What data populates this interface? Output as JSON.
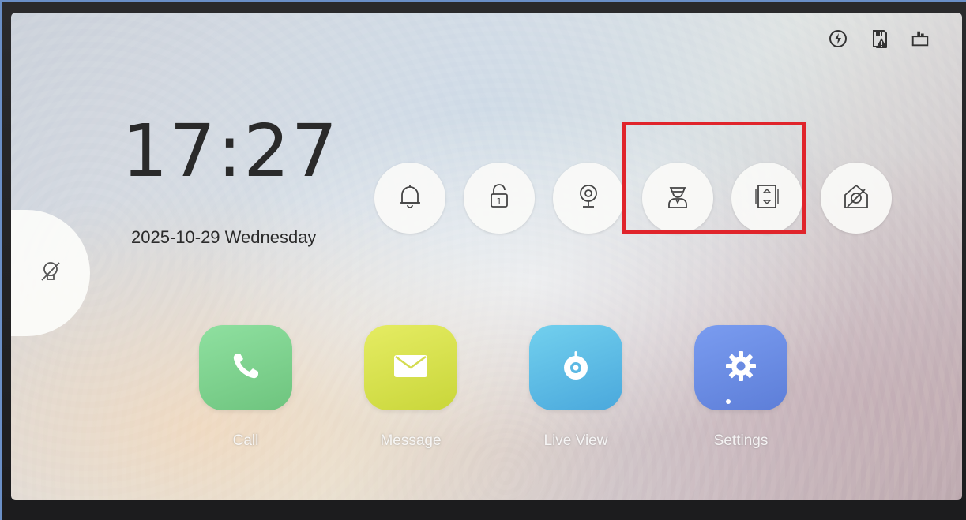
{
  "status_bar": {
    "icons": [
      "power-icon",
      "sd-card-warning-icon",
      "network-port-icon"
    ]
  },
  "clock": {
    "time": "17:27",
    "date": "2025-10-29 Wednesday"
  },
  "quick_actions": [
    {
      "icon": "bell-icon"
    },
    {
      "icon": "unlock-1-icon"
    },
    {
      "icon": "camera-icon"
    },
    {
      "icon": "guard-icon"
    },
    {
      "icon": "elevator-icon"
    },
    {
      "icon": "disarm-home-icon"
    }
  ],
  "highlight": {
    "color": "#e0242b"
  },
  "side_tab": {
    "icon": "light-off-icon"
  },
  "apps": [
    {
      "label": "Call",
      "icon": "phone-icon",
      "color": "#7fd08c"
    },
    {
      "label": "Message",
      "icon": "envelope-icon",
      "color": "#d6df49"
    },
    {
      "label": "Live View",
      "icon": "camera-eye-icon",
      "color": "#5ec0e6"
    },
    {
      "label": "Settings",
      "icon": "gear-icon",
      "color": "#6f8fe6"
    }
  ]
}
